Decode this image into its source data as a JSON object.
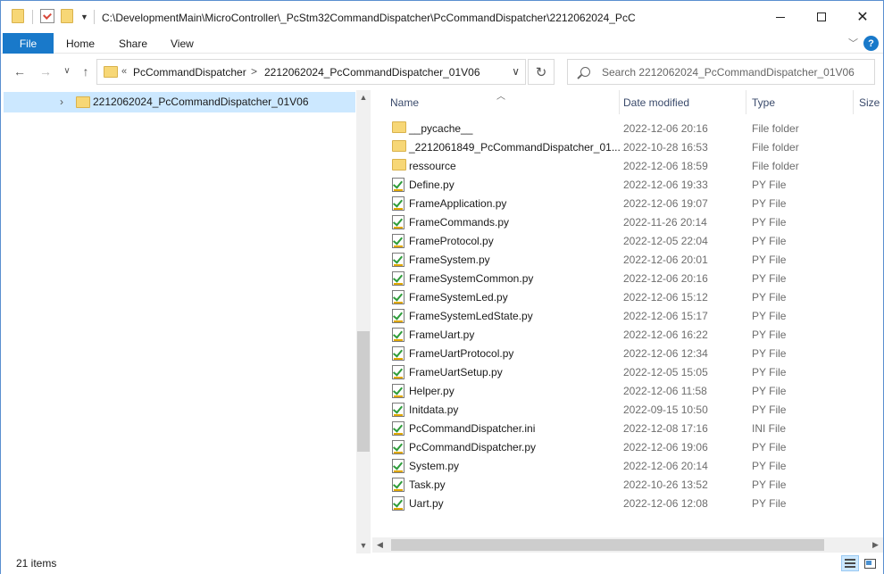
{
  "title_bar": {
    "path": "C:\\DevelopmentMain\\MicroController\\_PcStm32CommandDispatcher\\PcCommandDispatcher\\2212062024_PcC",
    "minimize": "—",
    "maximize": "□",
    "close": "✕"
  },
  "ribbon": {
    "tabs": [
      "File",
      "Home",
      "Share",
      "View"
    ],
    "expand_icon": "chevron-down-icon",
    "help_label": "?"
  },
  "address_bar": {
    "lead": "«",
    "crumbs": [
      "PcCommandDispatcher",
      "2212062024_PcCommandDispatcher_01V06"
    ],
    "separator": ">"
  },
  "search": {
    "placeholder": "Search 2212062024_PcCommandDispatcher_01V06"
  },
  "nav_pane": {
    "items": [
      {
        "label": "2212062024_PcCommandDispatcher_01V06",
        "selected": true
      }
    ]
  },
  "file_list": {
    "columns": [
      "Name",
      "Date modified",
      "Type",
      "Size"
    ],
    "sort_column": "Name",
    "rows": [
      {
        "name": "__pycache__",
        "date": "2022-12-06 20:16",
        "type": "File folder",
        "icon": "folder-icon"
      },
      {
        "name": "_2212061849_PcCommandDispatcher_01...",
        "date": "2022-10-28 16:53",
        "type": "File folder",
        "icon": "folder-icon"
      },
      {
        "name": "ressource",
        "date": "2022-12-06 18:59",
        "type": "File folder",
        "icon": "folder-icon"
      },
      {
        "name": "Define.py",
        "date": "2022-12-06 19:33",
        "type": "PY File",
        "icon": "python-file-icon"
      },
      {
        "name": "FrameApplication.py",
        "date": "2022-12-06 19:07",
        "type": "PY File",
        "icon": "python-file-icon"
      },
      {
        "name": "FrameCommands.py",
        "date": "2022-11-26 20:14",
        "type": "PY File",
        "icon": "python-file-icon"
      },
      {
        "name": "FrameProtocol.py",
        "date": "2022-12-05 22:04",
        "type": "PY File",
        "icon": "python-file-icon"
      },
      {
        "name": "FrameSystem.py",
        "date": "2022-12-06 20:01",
        "type": "PY File",
        "icon": "python-file-icon"
      },
      {
        "name": "FrameSystemCommon.py",
        "date": "2022-12-06 20:16",
        "type": "PY File",
        "icon": "python-file-icon"
      },
      {
        "name": "FrameSystemLed.py",
        "date": "2022-12-06 15:12",
        "type": "PY File",
        "icon": "python-file-icon"
      },
      {
        "name": "FrameSystemLedState.py",
        "date": "2022-12-06 15:17",
        "type": "PY File",
        "icon": "python-file-icon"
      },
      {
        "name": "FrameUart.py",
        "date": "2022-12-06 16:22",
        "type": "PY File",
        "icon": "python-file-icon"
      },
      {
        "name": "FrameUartProtocol.py",
        "date": "2022-12-06 12:34",
        "type": "PY File",
        "icon": "python-file-icon"
      },
      {
        "name": "FrameUartSetup.py",
        "date": "2022-12-05 15:05",
        "type": "PY File",
        "icon": "python-file-icon"
      },
      {
        "name": "Helper.py",
        "date": "2022-12-06 11:58",
        "type": "PY File",
        "icon": "python-file-icon"
      },
      {
        "name": "Initdata.py",
        "date": "2022-09-15 10:50",
        "type": "PY File",
        "icon": "python-file-icon"
      },
      {
        "name": "PcCommandDispatcher.ini",
        "date": "2022-12-08 17:16",
        "type": "INI File",
        "icon": "ini-file-icon"
      },
      {
        "name": "PcCommandDispatcher.py",
        "date": "2022-12-06 19:06",
        "type": "PY File",
        "icon": "python-file-icon"
      },
      {
        "name": "System.py",
        "date": "2022-12-06 20:14",
        "type": "PY File",
        "icon": "python-file-icon"
      },
      {
        "name": "Task.py",
        "date": "2022-10-26 13:52",
        "type": "PY File",
        "icon": "python-file-icon"
      },
      {
        "name": "Uart.py",
        "date": "2022-12-06 12:08",
        "type": "PY File",
        "icon": "python-file-icon"
      }
    ]
  },
  "status_bar": {
    "item_count": "21 items"
  },
  "colors": {
    "accent": "#1979ca",
    "selection": "#cce8ff",
    "folder": "#f7d776"
  }
}
